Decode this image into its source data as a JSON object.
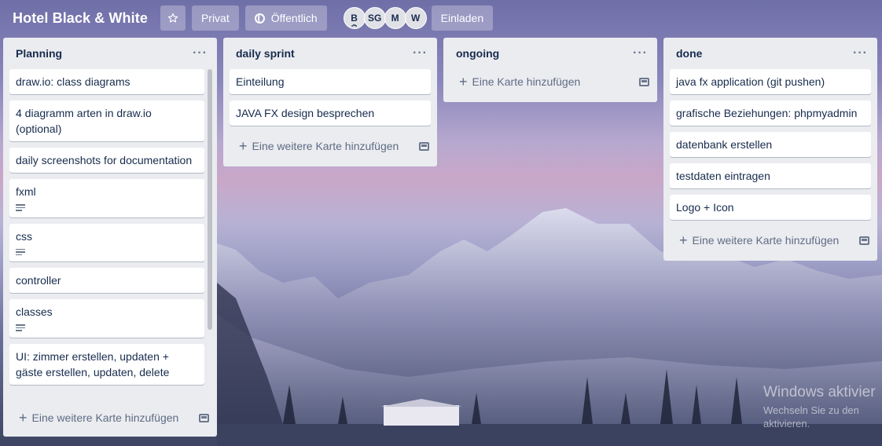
{
  "board": {
    "title": "Hotel Black & White",
    "star_icon": "star-icon",
    "visibility_private": "Privat",
    "visibility_public": "Öffentlich",
    "members": [
      "B",
      "SG",
      "M",
      "W"
    ],
    "invite_label": "Einladen"
  },
  "lists": {
    "planning": {
      "title": "Planning",
      "cards": [
        {
          "title": "draw.io: class diagrams"
        },
        {
          "title": "4 diagramm arten in draw.io (optional)"
        },
        {
          "title": "daily screenshots for documentation"
        },
        {
          "title": "fxml",
          "has_description": true
        },
        {
          "title": "css",
          "has_description": true
        },
        {
          "title": "controller"
        },
        {
          "title": "classes",
          "has_description": true
        },
        {
          "title": "UI: zimmer erstellen, updaten + gäste erstellen, updaten, delete"
        }
      ],
      "add_label": "Eine weitere Karte hinzufügen"
    },
    "daily": {
      "title": "daily sprint",
      "cards": [
        {
          "title": "Einteilung"
        },
        {
          "title": "JAVA FX design besprechen"
        }
      ],
      "add_label": "Eine weitere Karte hinzufügen"
    },
    "ongoing": {
      "title": "ongoing",
      "cards": [],
      "add_label": "Eine Karte hinzufügen"
    },
    "done": {
      "title": "done",
      "cards": [
        {
          "title": "java fx application (git pushen)"
        },
        {
          "title": "grafische Beziehungen: phpmyadmin"
        },
        {
          "title": "datenbank erstellen"
        },
        {
          "title": "testdaten eintragen"
        },
        {
          "title": "Logo + Icon"
        }
      ],
      "add_label": "Eine weitere Karte hinzufügen"
    }
  },
  "watermark": {
    "line1": "Windows aktivier",
    "line2": "Wechseln Sie zu den",
    "line3": "aktivieren."
  }
}
